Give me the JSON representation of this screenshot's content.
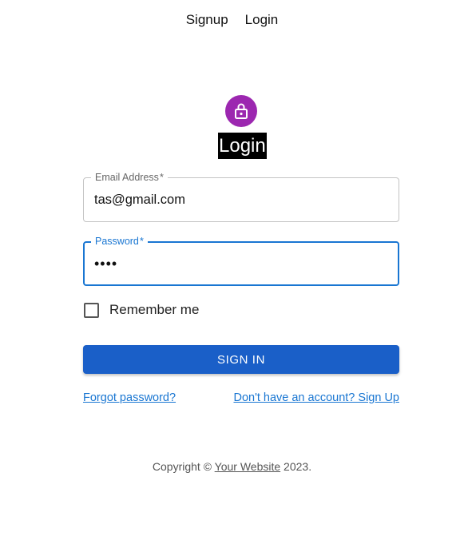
{
  "nav": {
    "signup_label": "Signup",
    "login_label": "Login"
  },
  "avatar": {
    "icon": "lock-icon",
    "color": "#9c27b0"
  },
  "form": {
    "title": "Login",
    "email": {
      "label": "Email Address",
      "required_marker": "*",
      "value": "tas@gmail.com"
    },
    "password": {
      "label": "Password",
      "required_marker": "*",
      "value": "••••"
    },
    "remember_label": "Remember me",
    "remember_checked": false,
    "submit_label": "Sign In",
    "forgot_link": "Forgot password?",
    "signup_link": "Don't have an account? Sign Up"
  },
  "footer": {
    "prefix": "Copyright ©",
    "link": "Your Website",
    "suffix": "2023."
  },
  "colors": {
    "primary": "#1976d2",
    "button": "#1a5fc8",
    "avatar": "#9c27b0"
  }
}
